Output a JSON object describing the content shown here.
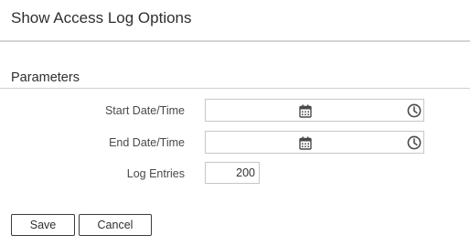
{
  "header": {
    "title": "Show Access Log Options"
  },
  "parameters": {
    "section_title": "Parameters",
    "start": {
      "label": "Start Date/Time",
      "value": ""
    },
    "end": {
      "label": "End Date/Time",
      "value": ""
    },
    "log_entries": {
      "label": "Log Entries",
      "value": "200"
    }
  },
  "icons": {
    "calendar": "calendar-icon",
    "clock": "clock-icon"
  },
  "actions": {
    "save": "Save",
    "cancel": "Cancel"
  },
  "colors": {
    "border": "#c7c7c7",
    "icon": "#4a4a4a",
    "button_border": "#3c3c3c"
  }
}
